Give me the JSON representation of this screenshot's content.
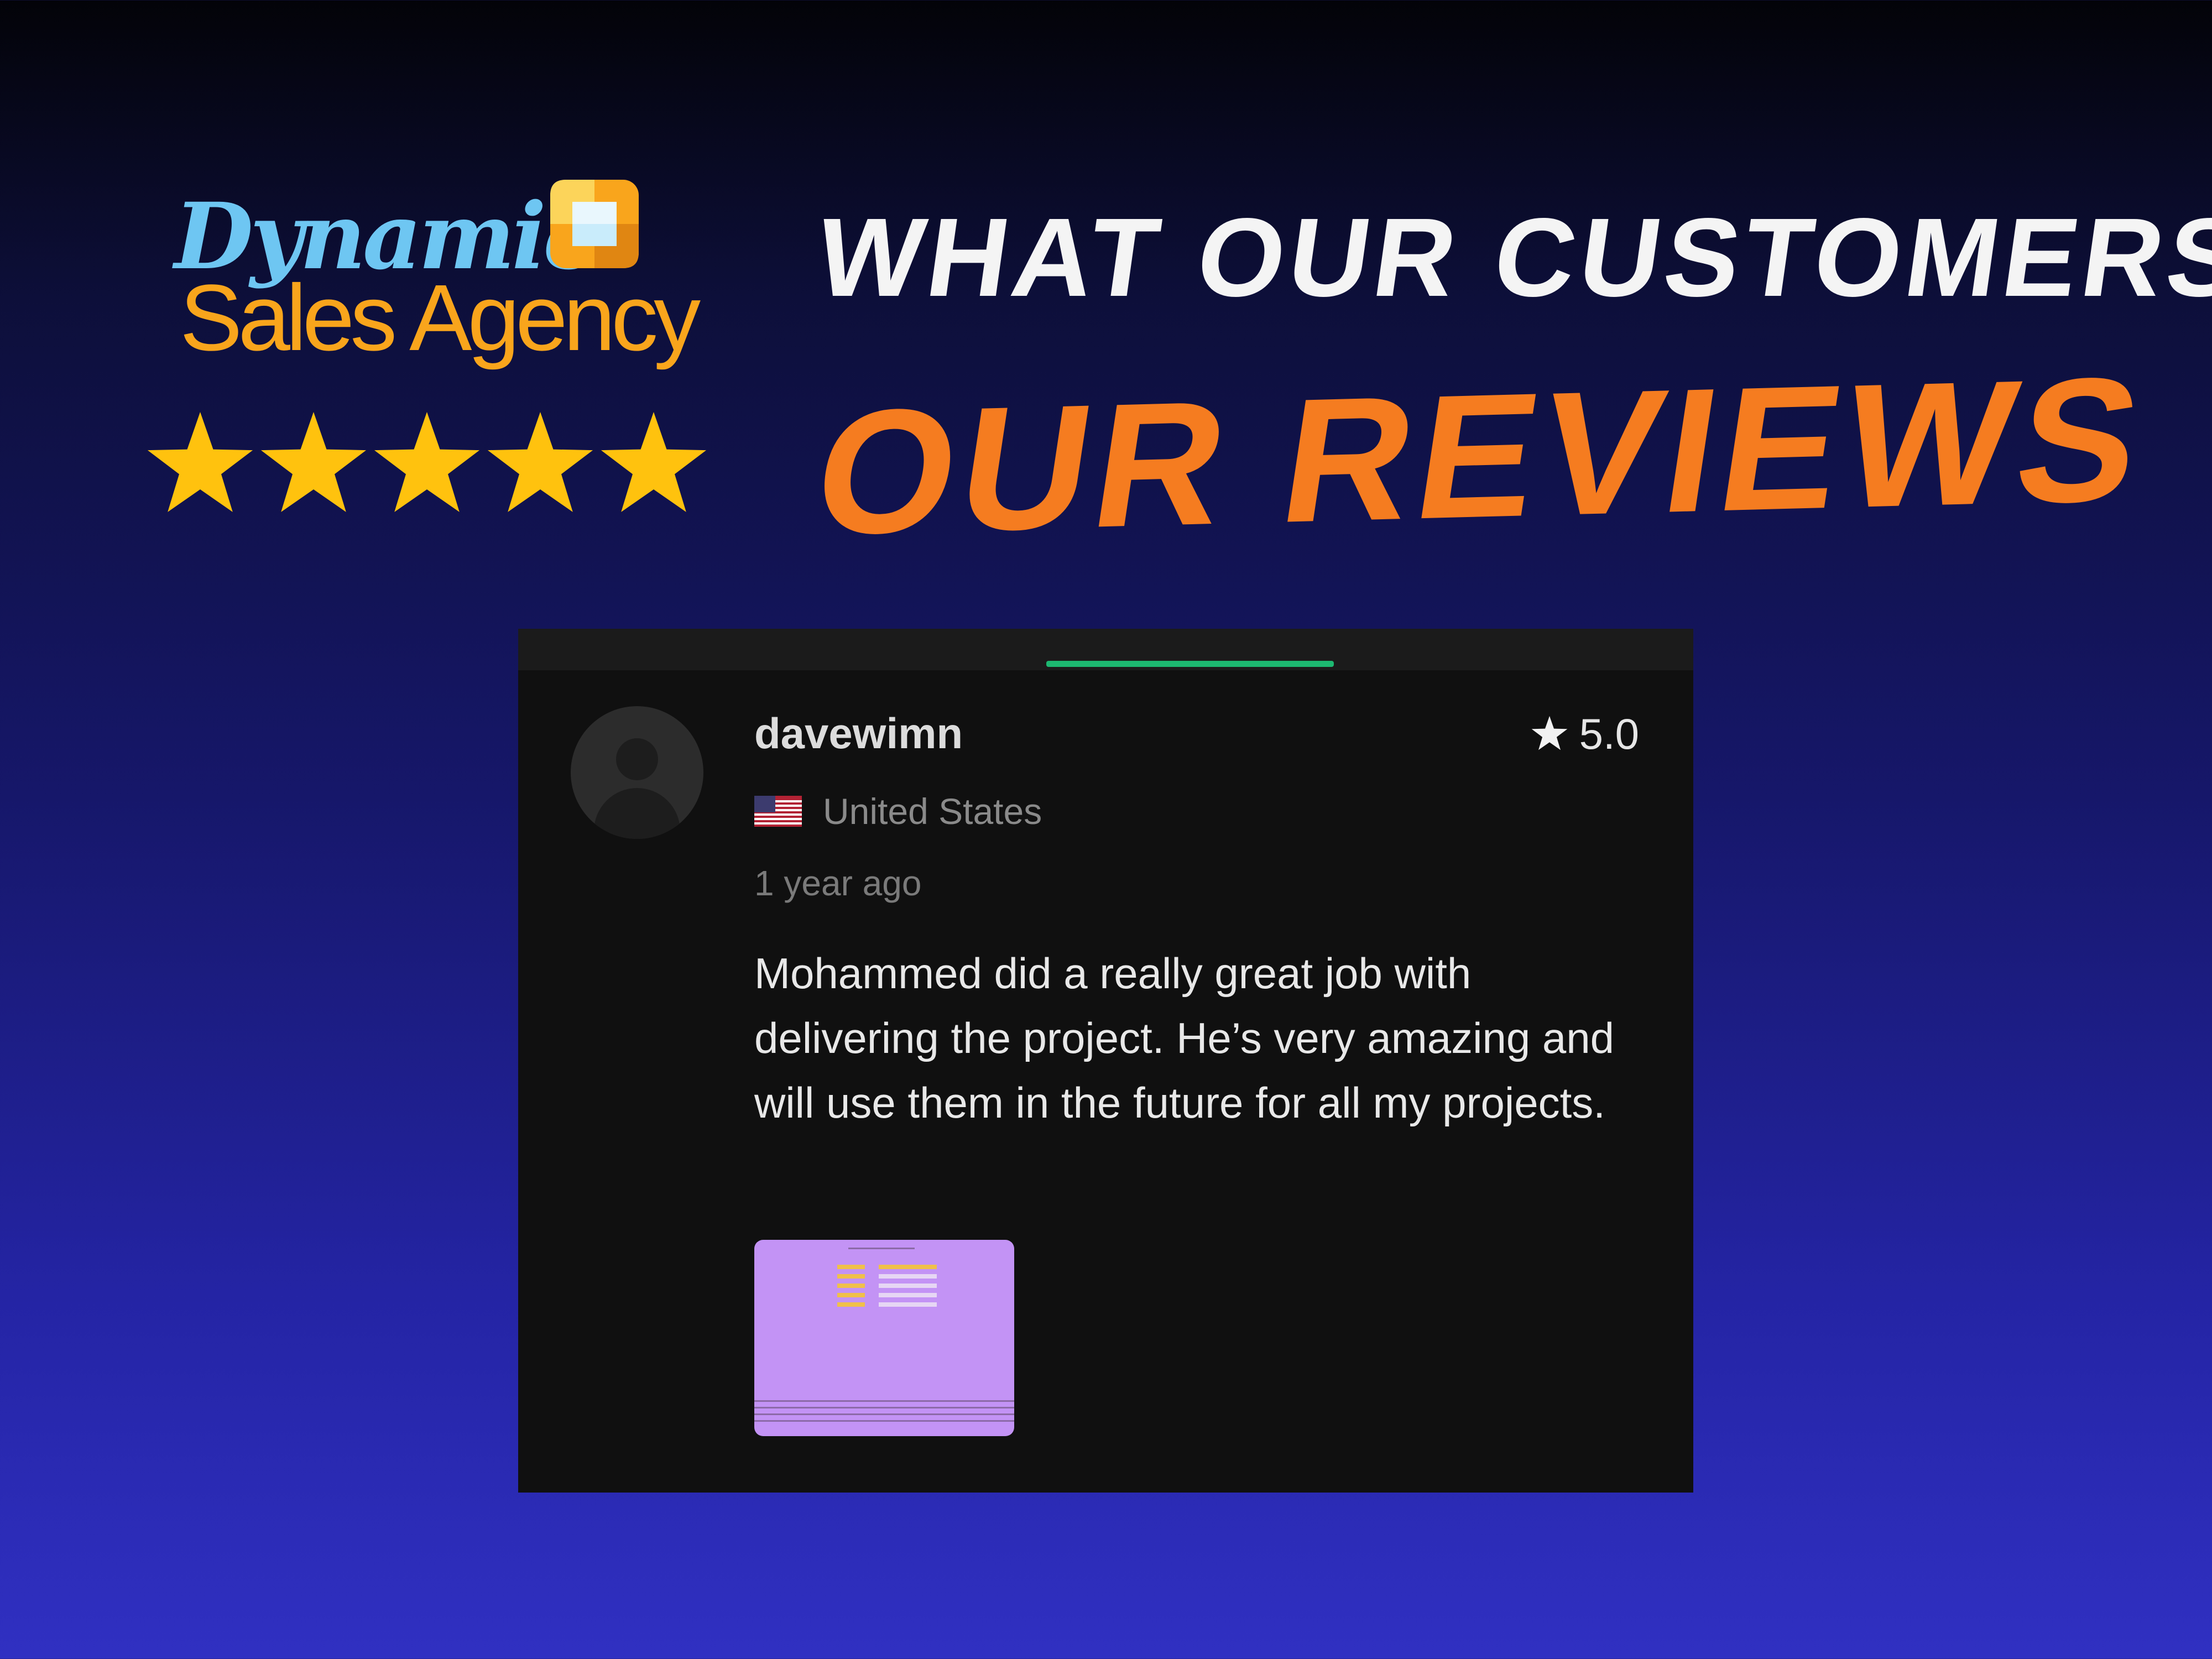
{
  "brand": {
    "line1": "Dynamic",
    "line2": "Sales Agency",
    "colors": {
      "line1": "#6ec6f2",
      "line2": "#f9a51c"
    }
  },
  "rating_stars": {
    "count": 5,
    "color": "#ffc20e"
  },
  "headline": {
    "small": "What Our Customers Say",
    "big": "Our Reviews",
    "colors": {
      "small": "#f4f4f4",
      "big": "#f57c20"
    }
  },
  "review": {
    "username": "davewimn",
    "rating": "5.0",
    "country": "United States",
    "time": "1 year ago",
    "text": "Mohammed did a really great job with delivering the project. He’s very amazing and will use them in the future for all my projects.",
    "accent_color": "#1db871",
    "icons": [
      "avatar-placeholder-icon",
      "star-icon",
      "us-flag-icon"
    ]
  }
}
